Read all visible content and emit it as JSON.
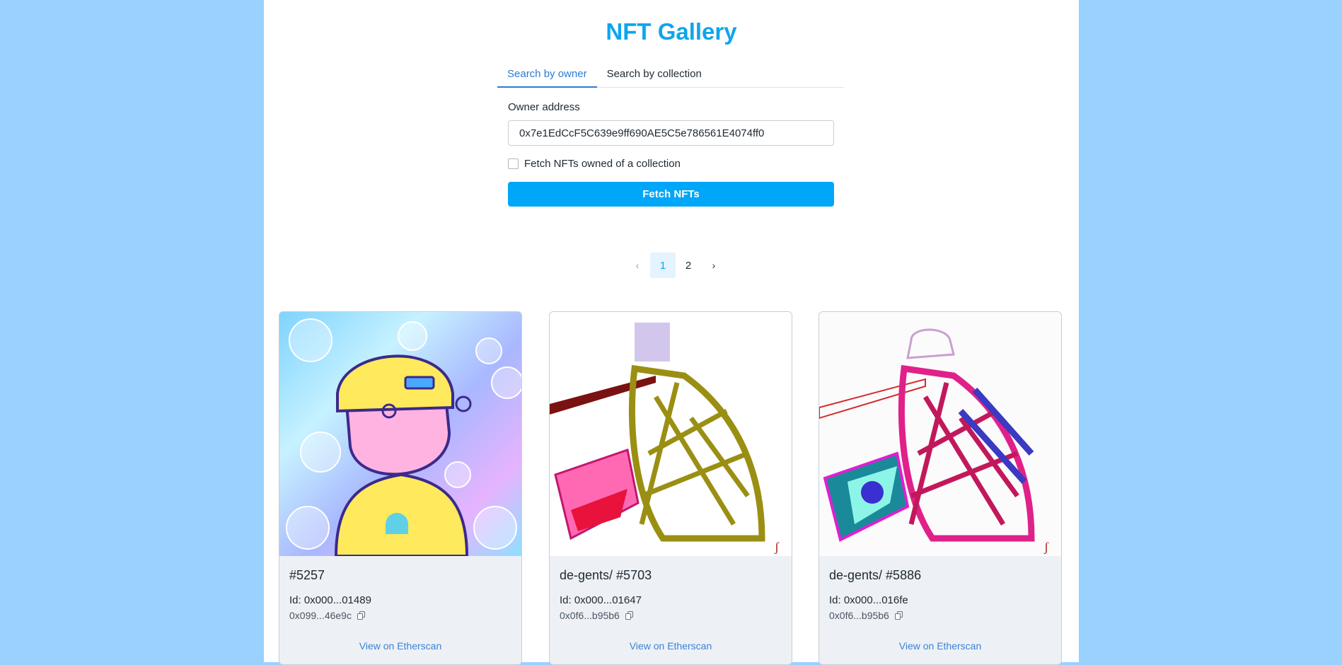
{
  "title": "NFT Gallery",
  "tabs": [
    {
      "label": "Search by owner",
      "active": true
    },
    {
      "label": "Search by collection",
      "active": false
    }
  ],
  "form": {
    "owner_label": "Owner address",
    "owner_value": "0x7e1EdCcF5C639e9ff690AE5C5e786561E4074ff0",
    "checkbox_label": "Fetch NFTs owned of a collection",
    "checkbox_checked": false,
    "button_label": "Fetch NFTs"
  },
  "pagination": {
    "prev": "‹",
    "pages": [
      "1",
      "2"
    ],
    "current": "1",
    "next": "›"
  },
  "cards": [
    {
      "title": "#5257",
      "id": "Id: 0x000...01489",
      "address": "0x099...46e9c",
      "link": "View on Etherscan"
    },
    {
      "title": "de-gents/ #5703",
      "id": "Id: 0x000...01647",
      "address": "0x0f6...b95b6",
      "link": "View on Etherscan"
    },
    {
      "title": "de-gents/ #5886",
      "id": "Id: 0x000...016fe",
      "address": "0x0f6...b95b6",
      "link": "View on Etherscan"
    }
  ],
  "colors": {
    "background": "#99d1ff",
    "accent": "#0ea5ee",
    "button": "#00a6f7",
    "link": "#3b82d8"
  }
}
